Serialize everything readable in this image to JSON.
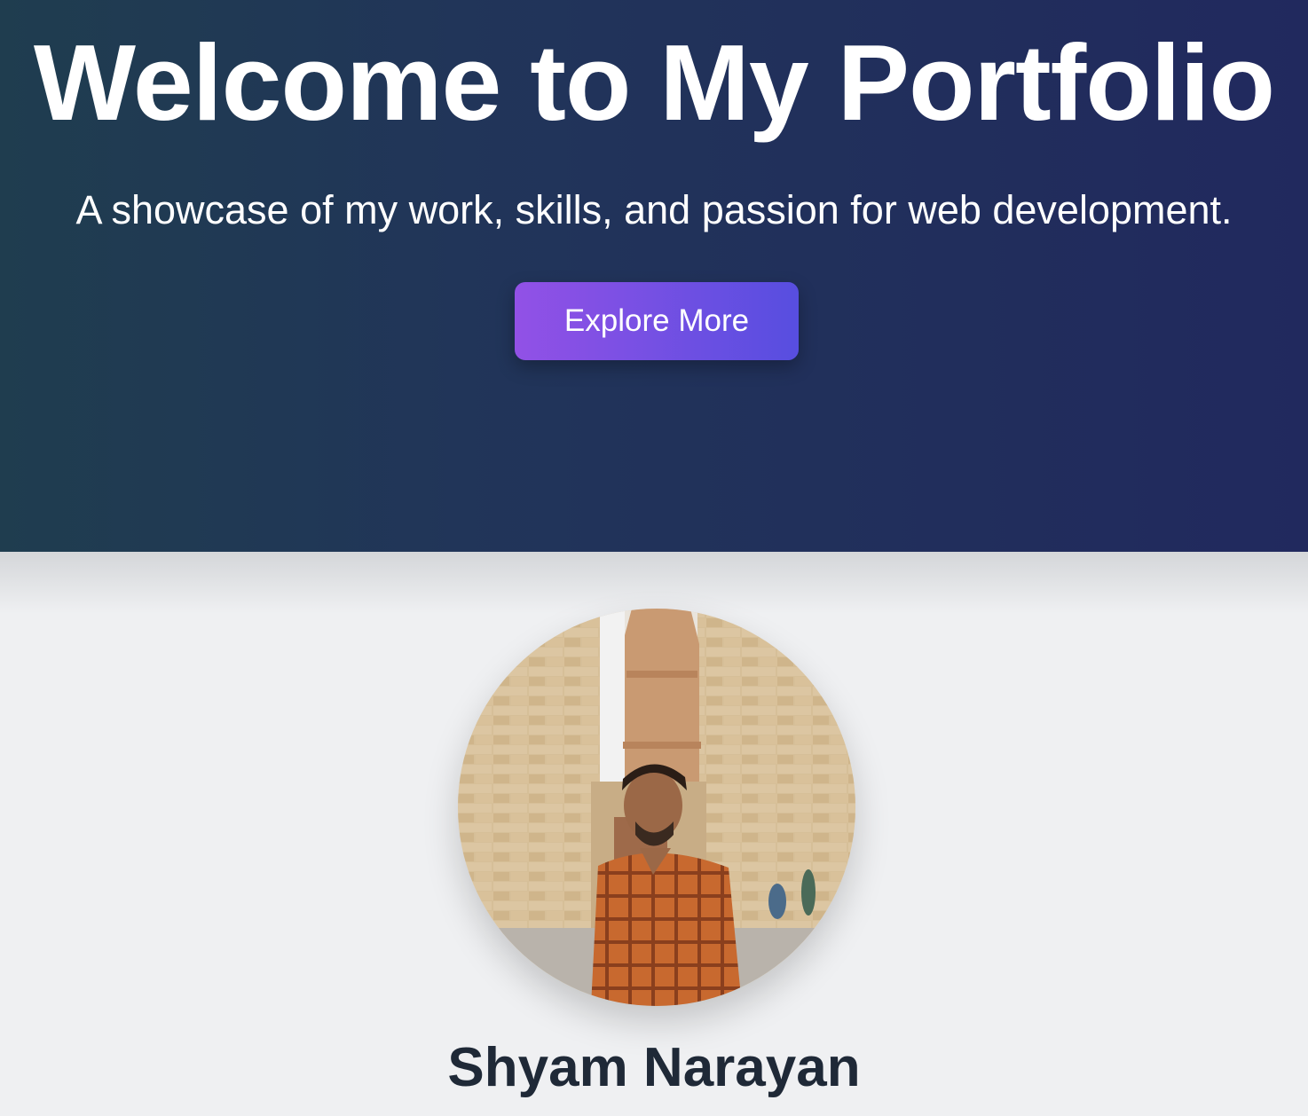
{
  "hero": {
    "title": "Welcome to My Portfolio",
    "subtitle": "A showcase of my work, skills, and passion for web development.",
    "cta_label": "Explore More"
  },
  "profile": {
    "name": "Shyam Narayan",
    "photo_icon": "profile-photo"
  },
  "colors": {
    "hero_gradient_start": "#1f3d4f",
    "hero_gradient_end": "#21295e",
    "button_gradient_start": "#9251e6",
    "button_gradient_end": "#574ee0",
    "page_background": "#eff0f2",
    "name_text": "#1f2937"
  }
}
